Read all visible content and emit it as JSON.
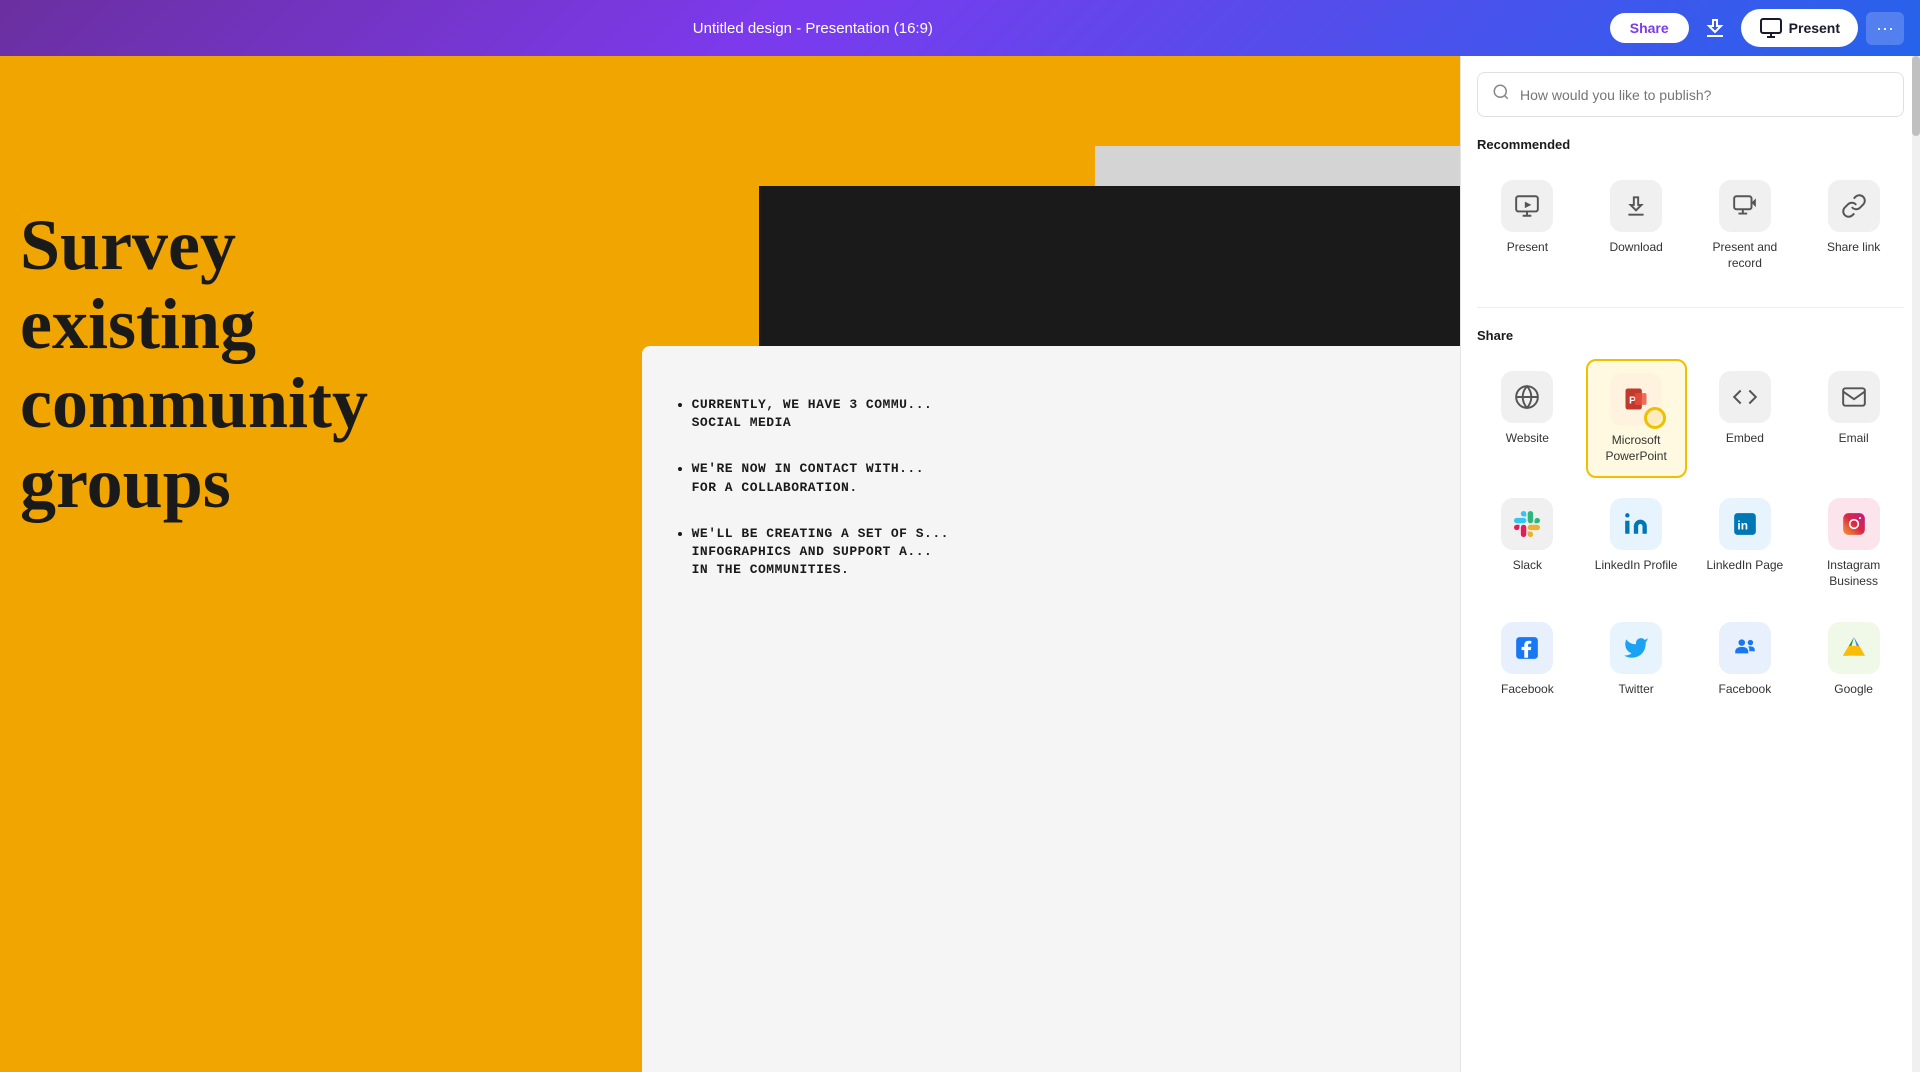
{
  "topbar": {
    "title": "Untitled design - Presentation (16:9)",
    "share_label": "Share",
    "present_label": "Present",
    "more_label": "···"
  },
  "slide": {
    "main_text": "Survey\nexisting\ncommunity\ngroups",
    "bullet1": "CURRENTLY, WE HAVE 3 COMMU...\nSOCIAL MEDIA",
    "bullet2": "WE'RE NOW IN CONTACT WITH...\nFOR A COLLABORATION.",
    "bullet3": "WE'LL BE CREATING A SET OF S...\nINFOGRAPHICS AND SUPPORT A...\nIN THE COMMUNITIES."
  },
  "publish_panel": {
    "search_placeholder": "How would you like to publish?",
    "recommended_label": "Recommended",
    "share_label": "Share",
    "options": {
      "recommended": [
        {
          "id": "present",
          "label": "Present",
          "icon": "present"
        },
        {
          "id": "download",
          "label": "Download",
          "icon": "download"
        },
        {
          "id": "present-record",
          "label": "Present and record",
          "icon": "present-record"
        },
        {
          "id": "share-link",
          "label": "Share link",
          "icon": "share-link"
        }
      ],
      "share": [
        {
          "id": "website",
          "label": "Website",
          "icon": "website"
        },
        {
          "id": "ms-ppt",
          "label": "Microsoft PowerPoint",
          "icon": "ms-ppt",
          "highlighted": true
        },
        {
          "id": "embed",
          "label": "Embed",
          "icon": "embed"
        },
        {
          "id": "email",
          "label": "Email",
          "icon": "email"
        },
        {
          "id": "slack",
          "label": "Slack",
          "icon": "slack"
        },
        {
          "id": "linkedin-profile",
          "label": "LinkedIn Profile",
          "icon": "linkedin-profile"
        },
        {
          "id": "linkedin-page",
          "label": "LinkedIn Page",
          "icon": "linkedin-page"
        },
        {
          "id": "instagram",
          "label": "Instagram Business",
          "icon": "instagram"
        },
        {
          "id": "facebook",
          "label": "Facebook",
          "icon": "facebook"
        },
        {
          "id": "twitter",
          "label": "Twitter",
          "icon": "twitter"
        },
        {
          "id": "facebook-group",
          "label": "Facebook",
          "icon": "facebook-group"
        },
        {
          "id": "google-drive",
          "label": "Google",
          "icon": "google-drive"
        }
      ]
    }
  }
}
